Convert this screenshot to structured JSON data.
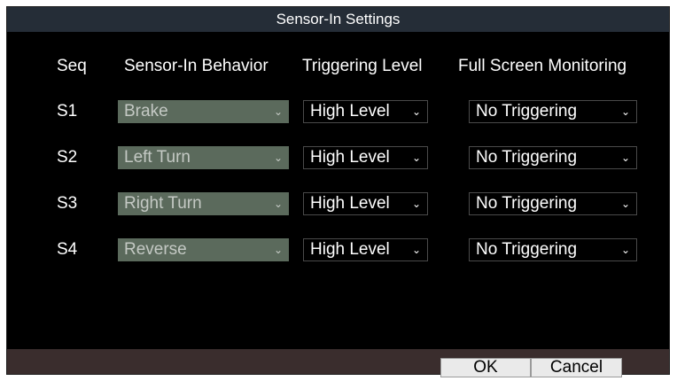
{
  "dialog": {
    "title": "Sensor-In Settings",
    "headers": {
      "seq": "Seq",
      "behavior": "Sensor-In Behavior",
      "trigger_level": "Triggering Level",
      "full_screen": "Full Screen Monitoring"
    },
    "rows": [
      {
        "seq": "S1",
        "behavior": "Brake",
        "trigger_level": "High Level",
        "full_screen": "No Triggering"
      },
      {
        "seq": "S2",
        "behavior": "Left Turn",
        "trigger_level": "High Level",
        "full_screen": "No Triggering"
      },
      {
        "seq": "S3",
        "behavior": "Right Turn",
        "trigger_level": "High Level",
        "full_screen": "No Triggering"
      },
      {
        "seq": "S4",
        "behavior": "Reverse",
        "trigger_level": "High Level",
        "full_screen": "No Triggering"
      }
    ],
    "buttons": {
      "ok": "OK",
      "cancel": "Cancel"
    },
    "dropdown_arrow": "⌄"
  },
  "colors": {
    "background": "#000000",
    "titlebar": "#252d37",
    "footer": "#3a2d2d",
    "disabled_dropdown": "#5b6a5c",
    "button": "#eaeaea"
  },
  "icons": {
    "dropdown": "chevron-down-icon"
  }
}
